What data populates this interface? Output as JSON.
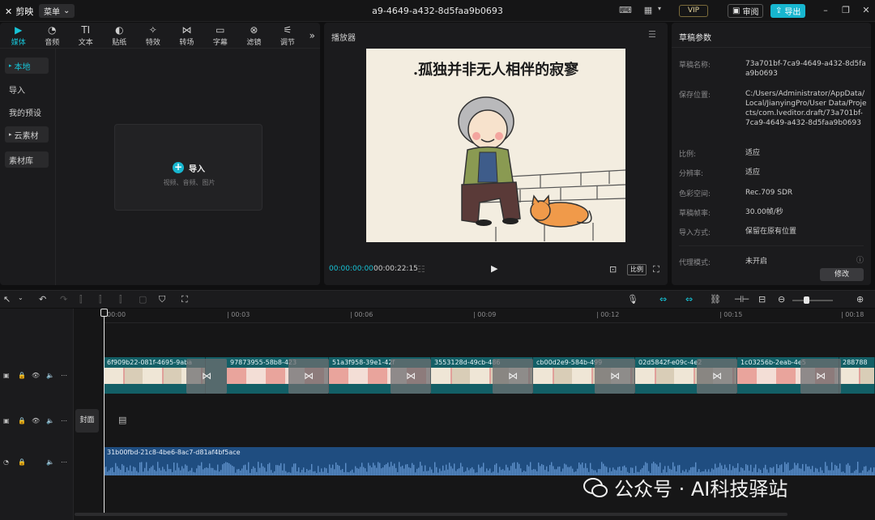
{
  "app": {
    "name": "剪映",
    "menu_label": "菜单",
    "project_title": "a9-4649-a432-8d5faa9b0693",
    "vip_label": "VIP",
    "review_label": "审阅",
    "export_label": "导出"
  },
  "toolbar": {
    "tabs": [
      {
        "label": "媒体",
        "icon": "media-icon",
        "active": true
      },
      {
        "label": "音频",
        "icon": "audio-icon"
      },
      {
        "label": "文本",
        "icon": "text-icon"
      },
      {
        "label": "贴纸",
        "icon": "sticker-icon"
      },
      {
        "label": "特效",
        "icon": "effects-icon"
      },
      {
        "label": "转场",
        "icon": "transition-icon"
      },
      {
        "label": "字幕",
        "icon": "subtitle-icon"
      },
      {
        "label": "滤镜",
        "icon": "filter-icon"
      },
      {
        "label": "调节",
        "icon": "adjust-icon"
      }
    ]
  },
  "sidebar": {
    "local": "本地",
    "import": "导入",
    "presets": "我的预设",
    "cloud": "云素材",
    "library": "素材库"
  },
  "import_box": {
    "label": "导入",
    "hint": "视频、音频、图片"
  },
  "player": {
    "title": "播放器",
    "caption": ".孤独并非无人相伴的寂寥",
    "time_current": "00:00:00:00",
    "time_total": "00:00:22:15",
    "ratio_label": "比例"
  },
  "props": {
    "title": "草稿参数",
    "rows": [
      {
        "label": "草稿名称:",
        "value": "73a701bf-7ca9-4649-a432-8d5faa9b0693"
      },
      {
        "label": "保存位置:",
        "value": "C:/Users/Administrator/AppData/Local/JianyingPro/User Data/Projects/com.lveditor.draft/73a701bf-7ca9-4649-a432-8d5faa9b0693"
      },
      {
        "label": "比例:",
        "value": "适应"
      },
      {
        "label": "分辨率:",
        "value": "适应"
      },
      {
        "label": "色彩空间:",
        "value": "Rec.709 SDR"
      },
      {
        "label": "草稿帧率:",
        "value": "30.00帧/秒"
      },
      {
        "label": "导入方式:",
        "value": "保留在原有位置"
      },
      {
        "label": "代理模式:",
        "value": "未开启"
      }
    ],
    "edit_label": "修改"
  },
  "timeline": {
    "ticks": [
      "00:00",
      "| 00:03",
      "| 00:06",
      "| 00:09",
      "| 00:12",
      "| 00:15",
      "| 00:18"
    ],
    "clips": [
      "6f909b22-081f-4695-9aba",
      "97873955-58b8-423",
      "51a3f958-39e1-42f",
      "3553128d-49cb-486",
      "cb00d2e9-584b-499",
      "02d5842f-e09c-4e2",
      "1c03256b-2eab-4e5",
      "288788"
    ],
    "cover_label": "封面",
    "audio_name": "31b00fbd-21c8-4be6-8ac7-d81af4bf5ace"
  },
  "watermark": "公众号 · AI科技驿站",
  "colors": {
    "accent": "#17b6cf",
    "video_track": "#135f66",
    "audio_track": "#1f4d80"
  }
}
